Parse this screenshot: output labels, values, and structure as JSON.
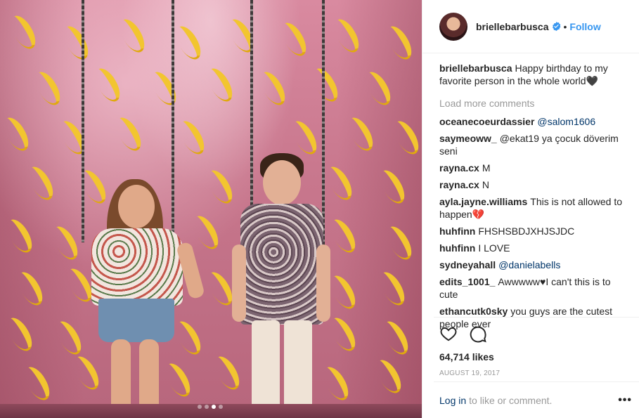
{
  "header": {
    "username": "briellebarbusca",
    "separator": "•",
    "follow_label": "Follow"
  },
  "caption": {
    "username": "briellebarbusca",
    "text": "Happy birthday to my favorite person in the whole world🖤"
  },
  "load_more_label": "Load more comments",
  "comments": [
    {
      "user": "oceanecoeurdassier",
      "text": "@salom1606",
      "mention": true
    },
    {
      "user": "saymeoww_",
      "text": "@ekat19 ya çocuk döverim seni",
      "mention": false
    },
    {
      "user": "rayna.cx",
      "text": "M",
      "mention": false
    },
    {
      "user": "rayna.cx",
      "text": "N",
      "mention": false
    },
    {
      "user": "ayla.jayne.williams",
      "text": "This is not allowed to happen💔",
      "mention": false
    },
    {
      "user": "huhfinn",
      "text": "FHSHSBDJXHJSJDC",
      "mention": false
    },
    {
      "user": "huhfinn",
      "text": "I LOVE",
      "mention": false
    },
    {
      "user": "sydneyahall",
      "text": "@danielabells",
      "mention": true
    },
    {
      "user": "edits_1001_",
      "text": "Awwwww♥I can't this is to cute",
      "mention": false
    },
    {
      "user": "ethancutk0sky",
      "text": "you guys are the cutest people ever",
      "mention": false
    }
  ],
  "actions": {
    "like_icon": "heart-icon",
    "comment_icon": "speech-bubble-icon",
    "likes_text": "64,714 likes",
    "date_text": "AUGUST 19, 2017"
  },
  "footer": {
    "login_link": "Log in",
    "login_rest": "to like or comment.",
    "more_icon": "•••"
  },
  "carousel": {
    "count": 4,
    "active": 2
  },
  "colors": {
    "accent": "#3897f0",
    "muted": "#999999",
    "link": "#003569",
    "text": "#262626"
  }
}
